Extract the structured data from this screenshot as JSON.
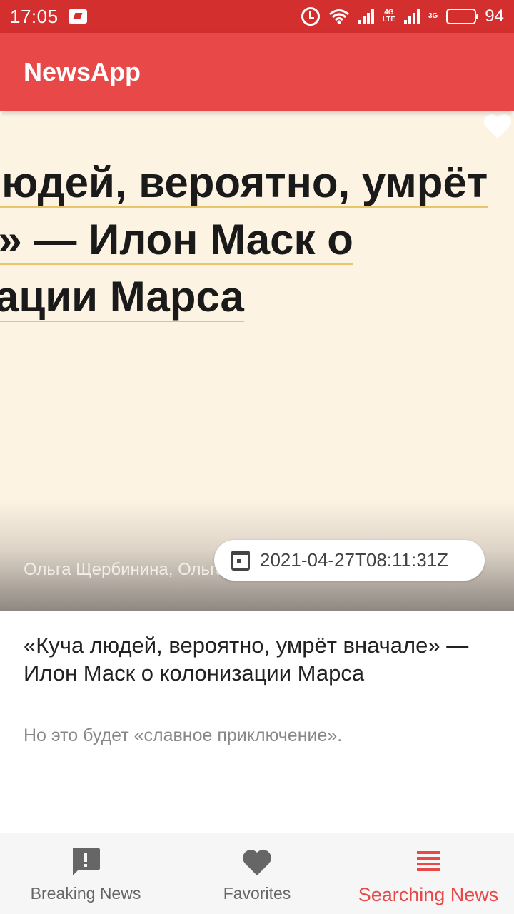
{
  "status_bar": {
    "time": "17:05",
    "network_1": "4G",
    "network_1_sub": "LTE",
    "network_2": "3G",
    "battery_level": "94",
    "battery_fraction": 0.94
  },
  "app_bar": {
    "title": "NewsApp",
    "color": "#e84848"
  },
  "article": {
    "image_headline_lines": [
      "людей, вероятно, умрёт",
      "е» — Илон Маск о",
      "зации Марса"
    ],
    "author": "Ольга Щербинина, Ольга",
    "published_at": "2021-04-27T08:11:31Z",
    "title": "«Куча людей, вероятно, умрёт вначале» — Илон Маск о колонизации Марса",
    "description": "Но это будет «славное приключение».",
    "favorite_icon": "heart-icon"
  },
  "bottom_nav": {
    "items": [
      {
        "label": "Breaking News",
        "icon": "alert-message-icon",
        "active": false
      },
      {
        "label": "Favorites",
        "icon": "heart-icon",
        "active": false
      },
      {
        "label": "Searching News",
        "icon": "list-icon",
        "active": true
      }
    ],
    "active_color": "#e84848"
  }
}
